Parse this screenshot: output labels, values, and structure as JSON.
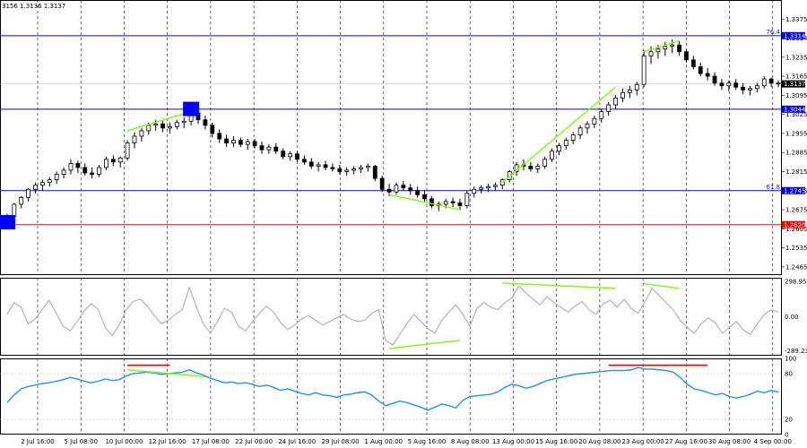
{
  "header": {
    "ohlc_text": "3156 1.3136 1.3137"
  },
  "colors": {
    "bull": "#000000",
    "bear": "#000000",
    "level": "#0000ff",
    "support": "#ff0000",
    "trend": "#7cfc00",
    "cci": "#b4b4b4",
    "rsi": "#1e90ff",
    "red_marker": "#ff0000",
    "price_tag": "#0000ff",
    "current_tag": "#000000",
    "grid": "#000000"
  },
  "chart_data": [
    {
      "type": "candlestick",
      "title": "",
      "ylim": [
        1.2435,
        1.3445
      ],
      "price_ticks": [
        "1.3375",
        "1.3314",
        "1.3235",
        "1.3165",
        "1.3095",
        "1.3025",
        "1.2955",
        "1.2885",
        "1.2815",
        "1.2745",
        "1.2675",
        "1.2605",
        "1.2535",
        "1.2465"
      ],
      "tick_values": [
        1.3375,
        1.3305,
        1.3235,
        1.3165,
        1.3095,
        1.3025,
        1.2955,
        1.2885,
        1.2815,
        1.2745,
        1.2675,
        1.2605,
        1.2535,
        1.2465
      ],
      "current_price": 1.3137,
      "current_label": "1.3137",
      "x_labels": [
        "2 Jul 16:00",
        "5 Jul 08:00",
        "10 Jul 00:00",
        "12 Jul 16:00",
        "17 Jul 08:00",
        "22 Jul 00:00",
        "24 Jul 16:00",
        "29 Jul 08:00",
        "1 Aug 00:00",
        "5 Aug 16:00",
        "8 Aug 08:00",
        "13 Aug 00:00",
        "15 Aug 16:00",
        "20 Aug 08:00",
        "23 Aug 00:00",
        "27 Aug 16:00",
        "30 Aug 08:00",
        "4 Sep 00:00"
      ],
      "levels": [
        {
          "name": "fib-76",
          "label": "76.4",
          "value": 1.3314,
          "tag": "1.3314",
          "color": "#0000ff"
        },
        {
          "name": "level-13044",
          "label": "",
          "value": 1.3044,
          "tag": "1.3044",
          "color": "#0000ff"
        },
        {
          "name": "fib-61",
          "label": "61.8",
          "value": 1.2745,
          "tag": "1.2745",
          "color": "#0000ff"
        },
        {
          "name": "level-12620",
          "label": "",
          "value": 1.262,
          "tag": "1.2620",
          "color": "#ff0000"
        }
      ],
      "trendlines": [
        {
          "t1": 17,
          "p1": 1.2965,
          "t2": 26,
          "p2": 1.3035
        },
        {
          "t1": 54,
          "p1": 1.273,
          "t2": 64,
          "p2": 1.2675
        },
        {
          "t1": 70,
          "p1": 1.2775,
          "t2": 86,
          "p2": 1.3125
        },
        {
          "t1": 90,
          "p1": 1.3255,
          "t2": 95,
          "p2": 1.3295
        }
      ],
      "markers": [
        {
          "type": "square",
          "t": 0,
          "p": 1.2629
        },
        {
          "type": "square",
          "t": 26,
          "p": 1.3045
        }
      ],
      "candles": [
        [
          1.2645,
          1.266,
          1.2625,
          1.265
        ],
        [
          1.265,
          1.27,
          1.264,
          1.2695
        ],
        [
          1.2695,
          1.2725,
          1.268,
          1.272
        ],
        [
          1.272,
          1.2755,
          1.2705,
          1.275
        ],
        [
          1.275,
          1.2775,
          1.2735,
          1.2765
        ],
        [
          1.2765,
          1.2785,
          1.2745,
          1.2775
        ],
        [
          1.2775,
          1.2795,
          1.276,
          1.2785
        ],
        [
          1.2785,
          1.2815,
          1.277,
          1.2805
        ],
        [
          1.2805,
          1.283,
          1.279,
          1.282
        ],
        [
          1.282,
          1.286,
          1.2805,
          1.2845
        ],
        [
          1.2845,
          1.2855,
          1.281,
          1.283
        ],
        [
          1.283,
          1.2845,
          1.28,
          1.281
        ],
        [
          1.281,
          1.283,
          1.279,
          1.2805
        ],
        [
          1.2805,
          1.284,
          1.2795,
          1.283
        ],
        [
          1.283,
          1.287,
          1.282,
          1.286
        ],
        [
          1.286,
          1.2875,
          1.2835,
          1.285
        ],
        [
          1.285,
          1.287,
          1.283,
          1.2865
        ],
        [
          1.2865,
          1.293,
          1.2855,
          1.292
        ],
        [
          1.292,
          1.296,
          1.29,
          1.2945
        ],
        [
          1.2945,
          1.2975,
          1.2925,
          1.2965
        ],
        [
          1.2965,
          1.2995,
          1.295,
          1.2985
        ],
        [
          1.2985,
          1.3005,
          1.2965,
          1.299
        ],
        [
          1.299,
          1.3,
          1.296,
          1.2975
        ],
        [
          1.2975,
          1.2995,
          1.2955,
          1.298
        ],
        [
          1.298,
          1.3005,
          1.297,
          1.2995
        ],
        [
          1.2995,
          1.3015,
          1.2975,
          1.3
        ],
        [
          1.3,
          1.3055,
          1.2985,
          1.303
        ],
        [
          1.303,
          1.3045,
          1.299,
          1.3005
        ],
        [
          1.3005,
          1.302,
          1.297,
          1.2985
        ],
        [
          1.2985,
          1.2995,
          1.294,
          1.2955
        ],
        [
          1.2955,
          1.297,
          1.292,
          1.2935
        ],
        [
          1.2935,
          1.295,
          1.2905,
          1.292
        ],
        [
          1.292,
          1.2945,
          1.2905,
          1.293
        ],
        [
          1.293,
          1.294,
          1.2905,
          1.2915
        ],
        [
          1.2915,
          1.2935,
          1.2895,
          1.2925
        ],
        [
          1.2925,
          1.2935,
          1.29,
          1.291
        ],
        [
          1.291,
          1.2925,
          1.288,
          1.2895
        ],
        [
          1.2895,
          1.2915,
          1.288,
          1.2905
        ],
        [
          1.2905,
          1.292,
          1.288,
          1.289
        ],
        [
          1.289,
          1.29,
          1.286,
          1.287
        ],
        [
          1.287,
          1.289,
          1.2855,
          1.288
        ],
        [
          1.288,
          1.289,
          1.285,
          1.286
        ],
        [
          1.286,
          1.2875,
          1.284,
          1.285
        ],
        [
          1.285,
          1.2865,
          1.2825,
          1.2835
        ],
        [
          1.2835,
          1.285,
          1.2815,
          1.284
        ],
        [
          1.284,
          1.2855,
          1.282,
          1.283
        ],
        [
          1.283,
          1.2845,
          1.2815,
          1.2825
        ],
        [
          1.2825,
          1.284,
          1.2805,
          1.2815
        ],
        [
          1.2815,
          1.283,
          1.28,
          1.282
        ],
        [
          1.282,
          1.2835,
          1.2805,
          1.2825
        ],
        [
          1.2825,
          1.284,
          1.281,
          1.283
        ],
        [
          1.283,
          1.2845,
          1.2815,
          1.2835
        ],
        [
          1.2835,
          1.284,
          1.278,
          1.279
        ],
        [
          1.279,
          1.28,
          1.274,
          1.275
        ],
        [
          1.275,
          1.277,
          1.2725,
          1.274
        ],
        [
          1.274,
          1.2775,
          1.273,
          1.2765
        ],
        [
          1.2765,
          1.278,
          1.2745,
          1.2755
        ],
        [
          1.2755,
          1.277,
          1.273,
          1.2745
        ],
        [
          1.2745,
          1.276,
          1.272,
          1.273
        ],
        [
          1.273,
          1.2745,
          1.2705,
          1.2715
        ],
        [
          1.2715,
          1.2725,
          1.268,
          1.269
        ],
        [
          1.269,
          1.2705,
          1.267,
          1.2695
        ],
        [
          1.2695,
          1.2715,
          1.268,
          1.2705
        ],
        [
          1.2705,
          1.272,
          1.2685,
          1.27
        ],
        [
          1.27,
          1.2715,
          1.2675,
          1.269
        ],
        [
          1.269,
          1.2745,
          1.268,
          1.2735
        ],
        [
          1.2735,
          1.276,
          1.272,
          1.275
        ],
        [
          1.275,
          1.2765,
          1.2735,
          1.2755
        ],
        [
          1.2755,
          1.277,
          1.274,
          1.276
        ],
        [
          1.276,
          1.2775,
          1.2745,
          1.2765
        ],
        [
          1.2765,
          1.279,
          1.275,
          1.2785
        ],
        [
          1.2785,
          1.282,
          1.2775,
          1.2815
        ],
        [
          1.2815,
          1.285,
          1.28,
          1.284
        ],
        [
          1.284,
          1.286,
          1.282,
          1.2835
        ],
        [
          1.2835,
          1.285,
          1.2815,
          1.2825
        ],
        [
          1.2825,
          1.2845,
          1.281,
          1.2835
        ],
        [
          1.2835,
          1.287,
          1.2825,
          1.286
        ],
        [
          1.286,
          1.29,
          1.285,
          1.289
        ],
        [
          1.289,
          1.292,
          1.2875,
          1.291
        ],
        [
          1.291,
          1.294,
          1.2895,
          1.293
        ],
        [
          1.293,
          1.296,
          1.2915,
          1.295
        ],
        [
          1.295,
          1.2985,
          1.2935,
          1.2975
        ],
        [
          1.2975,
          1.3,
          1.2955,
          1.299
        ],
        [
          1.299,
          1.302,
          1.2975,
          1.301
        ],
        [
          1.301,
          1.3045,
          1.2995,
          1.3035
        ],
        [
          1.3035,
          1.307,
          1.302,
          1.306
        ],
        [
          1.306,
          1.3095,
          1.3045,
          1.3085
        ],
        [
          1.3085,
          1.312,
          1.307,
          1.3105
        ],
        [
          1.3105,
          1.313,
          1.3085,
          1.3115
        ],
        [
          1.3115,
          1.3145,
          1.3095,
          1.3135
        ],
        [
          1.3135,
          1.326,
          1.3125,
          1.324
        ],
        [
          1.324,
          1.3275,
          1.321,
          1.3255
        ],
        [
          1.3255,
          1.328,
          1.323,
          1.3265
        ],
        [
          1.3265,
          1.329,
          1.324,
          1.3275
        ],
        [
          1.3275,
          1.33,
          1.325,
          1.328
        ],
        [
          1.328,
          1.3295,
          1.324,
          1.3255
        ],
        [
          1.3255,
          1.3265,
          1.3215,
          1.3225
        ],
        [
          1.3225,
          1.324,
          1.319,
          1.32
        ],
        [
          1.32,
          1.3215,
          1.3165,
          1.3175
        ],
        [
          1.3175,
          1.3195,
          1.315,
          1.3165
        ],
        [
          1.3165,
          1.318,
          1.313,
          1.314
        ],
        [
          1.314,
          1.3155,
          1.3115,
          1.313
        ],
        [
          1.313,
          1.315,
          1.311,
          1.314
        ],
        [
          1.314,
          1.3155,
          1.3115,
          1.3125
        ],
        [
          1.3125,
          1.314,
          1.31,
          1.3115
        ],
        [
          1.3115,
          1.313,
          1.3095,
          1.312
        ],
        [
          1.312,
          1.314,
          1.3105,
          1.313
        ],
        [
          1.313,
          1.3165,
          1.312,
          1.3155
        ],
        [
          1.3155,
          1.316,
          1.3125,
          1.314
        ],
        [
          1.314,
          1.315,
          1.3125,
          1.3137
        ]
      ]
    },
    {
      "type": "line",
      "title": "",
      "ylim": [
        -330,
        330
      ],
      "ticks": [
        "298.9583",
        "0.00",
        "-289.236"
      ],
      "tick_values": [
        298.9583,
        0,
        -289.236
      ],
      "color": "#b4b4b4",
      "values": [
        20,
        120,
        80,
        -60,
        -20,
        60,
        140,
        30,
        -80,
        -120,
        -40,
        50,
        110,
        60,
        -90,
        -160,
        -70,
        60,
        130,
        150,
        90,
        10,
        -60,
        -30,
        20,
        60,
        250,
        80,
        -60,
        -140,
        -40,
        70,
        40,
        -80,
        -120,
        -40,
        30,
        90,
        40,
        -50,
        -110,
        -70,
        -20,
        10,
        -30,
        -70,
        -40,
        -10,
        20,
        -20,
        -40,
        -30,
        30,
        60,
        -200,
        -240,
        -150,
        -60,
        20,
        -40,
        -100,
        -140,
        -30,
        40,
        100,
        20,
        -80,
        70,
        120,
        80,
        60,
        120,
        160,
        260,
        200,
        150,
        100,
        170,
        120,
        80,
        40,
        90,
        130,
        60,
        20,
        110,
        140,
        80,
        150,
        70,
        30,
        130,
        240,
        180,
        120,
        60,
        -30,
        -90,
        -140,
        -60,
        -10,
        -50,
        -140,
        -90,
        -40,
        -110,
        -150,
        -60,
        20,
        60,
        40
      ],
      "trendlines": [
        {
          "t1": 54,
          "p1": -270,
          "t2": 64,
          "p2": -200
        },
        {
          "t1": 70,
          "p1": 285,
          "t2": 86,
          "p2": 240
        },
        {
          "t1": 90,
          "p1": 280,
          "t2": 95,
          "p2": 240
        }
      ]
    },
    {
      "type": "line",
      "title": "",
      "ylim": [
        0,
        100
      ],
      "ticks": [
        "100",
        "80",
        "20",
        "0"
      ],
      "tick_values": [
        100,
        80,
        20,
        0
      ],
      "color": "#1e90ff",
      "values": [
        42,
        52,
        60,
        63,
        65,
        67,
        68,
        70,
        72,
        75,
        73,
        70,
        68,
        70,
        73,
        71,
        72,
        77,
        80,
        81,
        82,
        81,
        79,
        80,
        81,
        82,
        85,
        81,
        78,
        74,
        71,
        68,
        69,
        67,
        68,
        66,
        63,
        65,
        62,
        58,
        60,
        57,
        54,
        52,
        55,
        52,
        51,
        49,
        52,
        53,
        55,
        56,
        52,
        44,
        38,
        41,
        44,
        42,
        39,
        36,
        32,
        36,
        40,
        38,
        35,
        45,
        50,
        51,
        52,
        53,
        56,
        62,
        66,
        64,
        61,
        63,
        67,
        71,
        73,
        75,
        77,
        79,
        80,
        81,
        82,
        83,
        84,
        84,
        84,
        85,
        88,
        86,
        86,
        85,
        84,
        82,
        75,
        66,
        60,
        58,
        55,
        52,
        54,
        50,
        48,
        50,
        53,
        57,
        55,
        58,
        56
      ],
      "markers": [
        {
          "type": "hline",
          "t1": 17,
          "t2": 23,
          "value": 91,
          "color": "#ff0000"
        },
        {
          "type": "hline",
          "t1": 85,
          "t2": 99,
          "value": 91,
          "color": "#ff0000"
        },
        {
          "type": "trend",
          "t1": 17,
          "p1": 85,
          "t2": 28,
          "p2": 76,
          "color": "#7cfc00"
        }
      ]
    }
  ]
}
